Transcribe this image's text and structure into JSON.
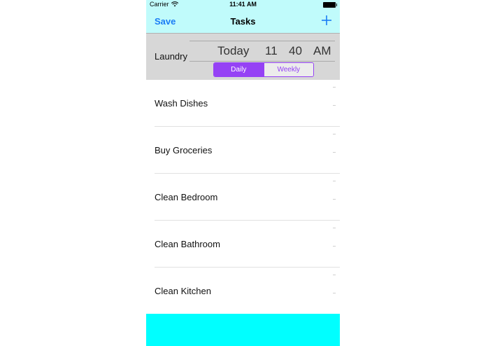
{
  "status_bar": {
    "carrier": "Carrier",
    "time": "11:41 AM"
  },
  "nav": {
    "save_label": "Save",
    "title": "Tasks",
    "add_icon": "plus-icon"
  },
  "editor": {
    "task_name": "Laundry",
    "picker": {
      "day": "Today",
      "hour": "11",
      "minute": "40",
      "ampm": "AM"
    },
    "frequency": {
      "options": [
        "Daily",
        "Weekly"
      ],
      "selected": "Daily"
    }
  },
  "tasks": [
    "Wash Dishes",
    "Buy Groceries",
    "Clean Bedroom",
    "Clean Bathroom",
    "Clean Kitchen"
  ],
  "colors": {
    "header_bg": "#c0fbfb",
    "accent_blue": "#1a7cf5",
    "accent_purple": "#9542f5",
    "bottom_bar": "#00ffff",
    "editor_bg": "#d7d7d7"
  }
}
